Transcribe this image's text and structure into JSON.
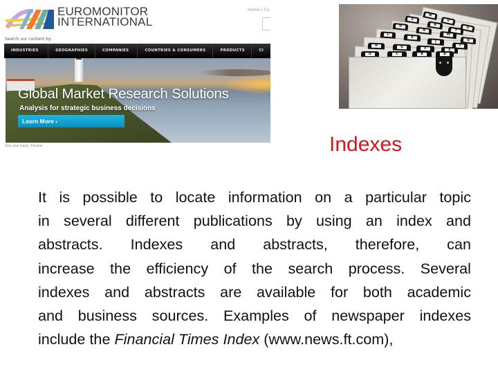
{
  "slide": {
    "title": "Indexes",
    "title_color": "#d9141b",
    "body_lines": [
      "It is possible to locate information on a particular topic",
      "in several different publications by using an index and",
      "abstracts. Indexes and abstracts, therefore, can",
      "increase the efficiency of the search process. Several",
      "indexes and abstracts are available for both academic",
      "and business sources. Examples of newspaper indexes"
    ],
    "last_line": {
      "before": "include the ",
      "italic": "Financial Times Index",
      "after": " (www.news.ft.com),"
    }
  },
  "website_screenshot": {
    "brand_line1": "EUROMONITOR",
    "brand_line2": "INTERNATIONAL",
    "top_links": "Home | Co",
    "search_by_label": "Search our content by:",
    "nav_items": [
      "INDUSTRIES",
      "GEOGRAPHIES",
      "COMPANIES",
      "COUNTRIES & CONSUMERS",
      "PRODUCTS",
      "CI"
    ],
    "hero_title": "Global Market Research Solutions",
    "hero_subtitle": "Analysis for strategic business decisions",
    "cta_label": "Learn More ›",
    "cta_color": "#1aa3d4",
    "breadcrumb": "You are here: Home"
  },
  "index_photo": {
    "tabs_front_row": [
      "D",
      "C",
      "B",
      "A"
    ],
    "tabs_row2": [
      "H",
      "G",
      "F",
      "E"
    ],
    "tabs_row3": [
      "L",
      "K",
      "J",
      "I"
    ],
    "tabs_row4": [
      "O",
      "N",
      "M",
      "Q"
    ],
    "tabs_row5": [
      "S",
      "R",
      "T"
    ],
    "tabs_row6": [
      "W",
      "V",
      "U"
    ]
  }
}
